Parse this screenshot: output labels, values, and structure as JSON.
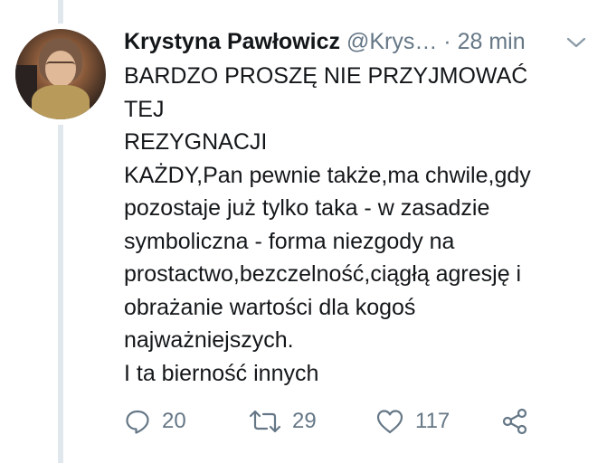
{
  "tweet": {
    "author_name": "Krystyna Pawłowicz",
    "handle": "@Krys…",
    "separator": "·",
    "time": "28 min",
    "lines": [
      "BARDZO PROSZĘ NIE PRZYJMOWAĆ",
      "TEJ",
      "REZYGNACJI",
      "KAŻDY,Pan pewnie także,ma chwile,gdy",
      "pozostaje już tylko taka - w zasadzie",
      "symboliczna - forma niezgody na",
      "prostactwo,bezczelność,ciągłą agresję i",
      "obrażanie wartości dla kogoś",
      "najważniejszych.",
      "I ta bierność innych"
    ],
    "actions": {
      "reply_count": "20",
      "retweet_count": "29",
      "like_count": "117"
    }
  },
  "icons": {
    "reply": "speech-bubble-icon",
    "retweet": "retweet-arrows-icon",
    "like": "heart-icon",
    "share": "share-nodes-icon",
    "menu": "chevron-down-icon"
  },
  "colors": {
    "text": "#14171a",
    "muted": "#657786",
    "thread_line": "#e1e8ed"
  }
}
